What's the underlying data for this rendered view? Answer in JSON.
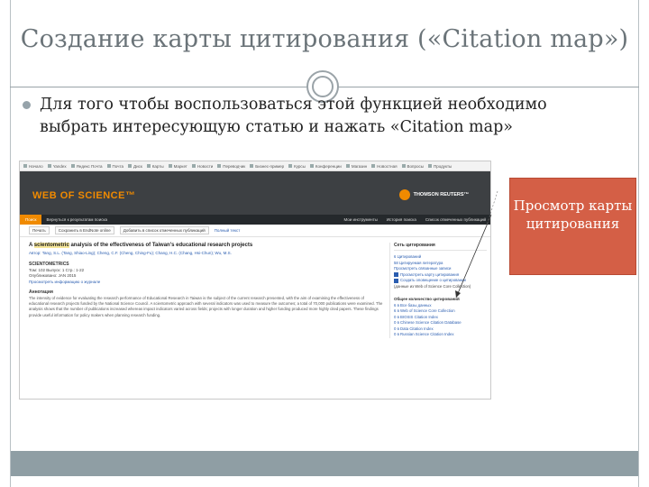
{
  "slide": {
    "title": "Создание карты цитирования («Citation map»)",
    "bullet": "Для того чтобы воспользоваться этой функцией необходимо выбрать интересующую статью и нажать «Citation map»",
    "callout": "Просмотр карты цитирования"
  },
  "screenshot": {
    "bookmarks": [
      "Начало",
      "Yandex",
      "Яндекс Почта",
      "Почта",
      "Диск",
      "Карты",
      "Маркет",
      "Новости",
      "Переводчик",
      "Бизнес-пример",
      "Курсы",
      "Конференции",
      "Магазин",
      "Новостная",
      "Вопросы",
      "Продукты"
    ],
    "header": {
      "logo": "WEB OF SCIENCE™",
      "publisher": "THOMSON REUTERS™"
    },
    "nav": {
      "home": "Поиск",
      "back": "Вернуться к результатам поиска",
      "right_items": [
        "Мои инструменты",
        "История поиска",
        "Список отмеченных публикаций"
      ]
    },
    "toolbar": {
      "print": "Печать",
      "save": "Сохранить в EndNote online",
      "add": "Добавить в список отмеченных публикаций",
      "links": "Полный текст"
    },
    "article": {
      "title_pre": "A ",
      "title_hl": "scientometric",
      "title_post": " analysis of the effectiveness of Taiwan's educational research projects",
      "authors": "Автор: Tang, S.L. (Tang, Shiao-Ling); Cheng, C.F. (Cheng, Ching-Fu); Chang, H.C. (Chang, Hsi-Chun); Wu, M.S.",
      "journal": "SCIENTOMETRICS",
      "volume": "Том: 102   Выпуск: 1   Стр.: 1-22",
      "published": "Опубликовано: JAN 2015",
      "view_journal": "Просмотреть информацию о журнале",
      "abstract_heading": "Аннотация",
      "abstract": "The intensity of evidence for evaluating the research performance of Educational Research in Taiwan is the subject of the current research presented, with the aim of examining the effectiveness of educational research projects funded by the National Science Council. A scientometric approach with several indicators was used to measure the outcomes; a total of 70,000 publications were examined. The analysis shows that the number of publications increased whereas impact indicators varied across fields; projects with longer duration and higher funding produced more highly cited papers. These findings provide useful information for policy makers when planning research funding."
    },
    "sidebar": {
      "heading": "Сеть цитирования",
      "times_cited": "6 Цитирований",
      "cited_refs": "58 Цитируемая литература",
      "related": "Просмотреть связанные записи",
      "citation_map": "Просмотреть карту цитирования",
      "alert": "Создать оповещение о цитировании",
      "data_note": "(данные из Web of Science Core Collection)",
      "usage_heading": "Общее количество цитирований",
      "usage_lines": [
        "6 в Все базы данных",
        "6 в Web of Science Core Collection",
        "0 в BIOSIS Citation Index",
        "0 в Chinese Science Citation Database",
        "0 в Data Citation Index",
        "0 в Russian Science Citation Index"
      ]
    }
  },
  "colors": {
    "title": "#6b7479",
    "callout_bg": "#d45f46",
    "wos_orange": "#f08a00",
    "footer": "#8f9ea4"
  }
}
